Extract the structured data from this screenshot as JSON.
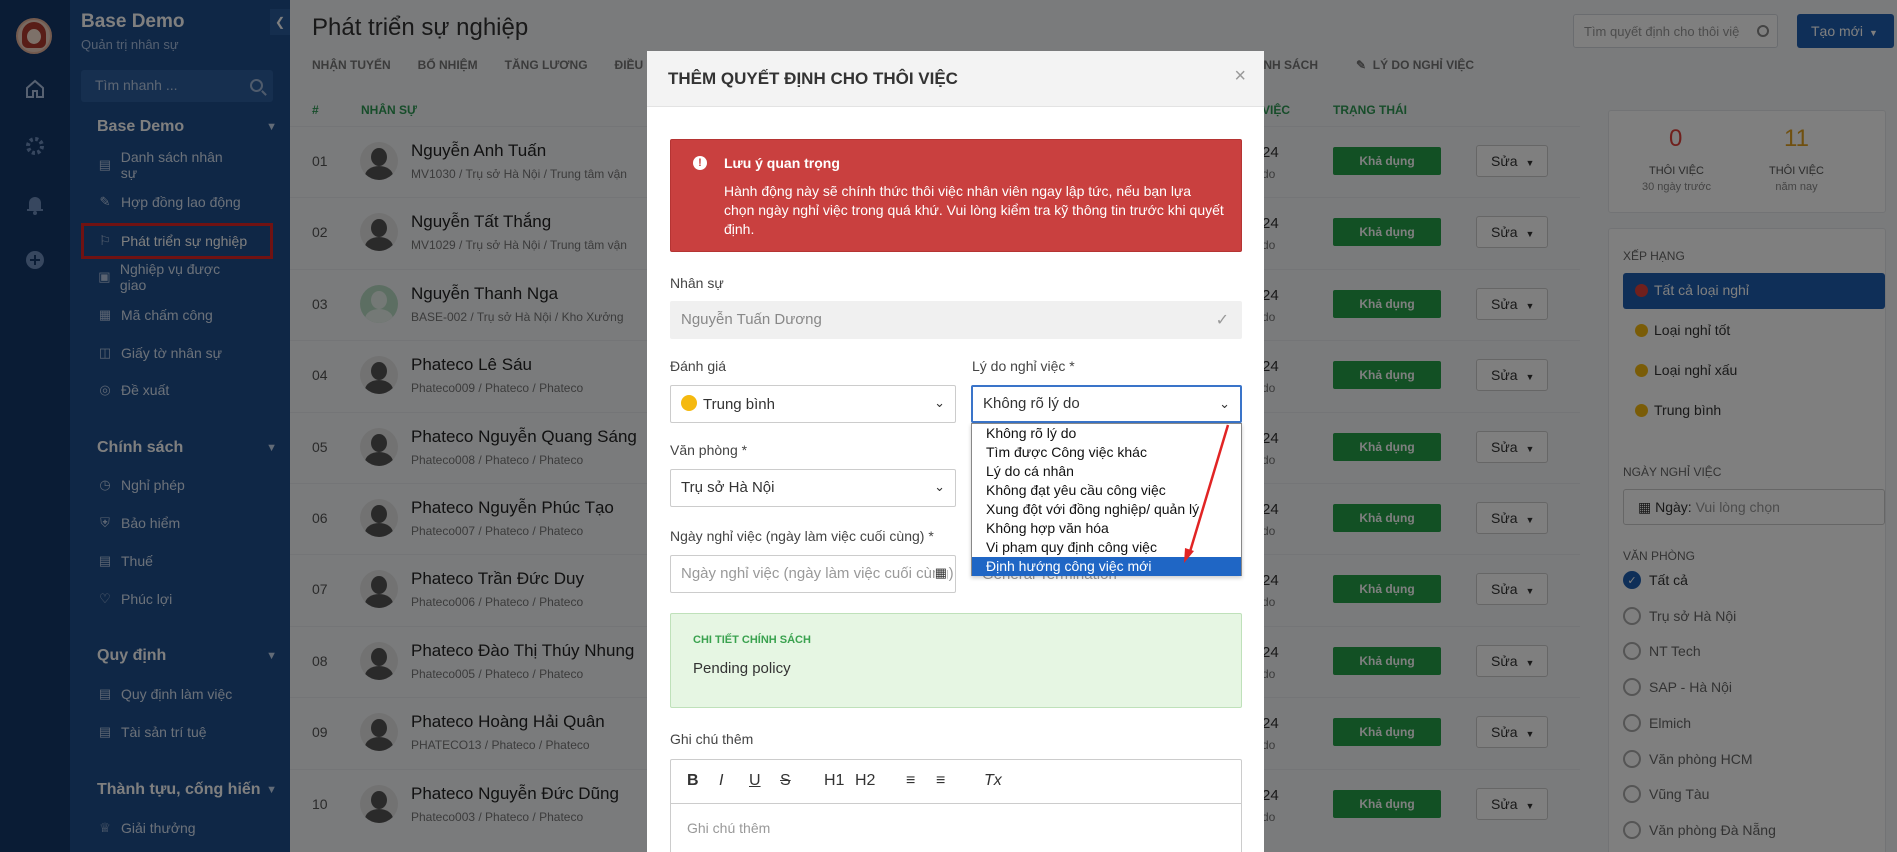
{
  "sidebar": {
    "brand": "Base Demo",
    "subtitle": "Quản trị nhân sự",
    "search_placeholder": "Tìm nhanh ...",
    "group1": "Base Demo",
    "group1_items": [
      "Danh sách nhân sự",
      "Hợp đồng lao động",
      "Phát triển sự nghiệp",
      "Nghiệp vụ được giao",
      "Mã chấm công",
      "Giấy tờ nhân sự",
      "Đề xuất"
    ],
    "group2": "Chính sách",
    "group2_items": [
      "Nghỉ phép",
      "Bảo hiểm",
      "Thuế",
      "Phúc lợi"
    ],
    "group3": "Quy định",
    "group3_items": [
      "Quy định làm việc",
      "Tài sản trí tuệ"
    ],
    "group4": "Thành tựu, cống hiến",
    "group4_items": [
      "Giải thưởng"
    ]
  },
  "header": {
    "title": "Phát triển sự nghiệp",
    "search_placeholder": "Tìm quyết định cho thôi việ",
    "create_label": "Tạo mới",
    "tabs": [
      "NHẬN TUYỂN",
      "BỔ NHIỆM",
      "TĂNG LƯƠNG",
      "ĐIỀU"
    ],
    "tabs_right": [
      "ÍNH SÁCH",
      "LÝ DO NGHỈ VIỆC"
    ]
  },
  "table": {
    "col_num": "#",
    "col_staff": "NHÂN SỰ",
    "col_date": "VIỆC",
    "col_status": "TRẠNG THÁI",
    "rows": [
      {
        "num": "01",
        "name": "Nguyễn Anh Tuấn",
        "sub": "MV1030 / Trụ sở Hà Nội / Trung tâm vận",
        "d1": "24",
        "d2": "do",
        "status": "Khả dụng",
        "edit": "Sửa"
      },
      {
        "num": "02",
        "name": "Nguyễn Tất Thắng",
        "sub": "MV1029 / Trụ sở Hà Nội / Trung tâm vận",
        "d1": "24",
        "d2": "do",
        "status": "Khả dụng",
        "edit": "Sửa"
      },
      {
        "num": "03",
        "name": "Nguyễn Thanh Nga",
        "sub": "BASE-002 / Trụ sở Hà Nội / Kho Xưởng",
        "d1": "24",
        "d2": "do",
        "status": "Khả dụng",
        "edit": "Sửa"
      },
      {
        "num": "04",
        "name": "Phateco Lê Sáu",
        "sub": "Phateco009 / Phateco / Phateco",
        "d1": "24",
        "d2": "do",
        "status": "Khả dụng",
        "edit": "Sửa"
      },
      {
        "num": "05",
        "name": "Phateco Nguyễn Quang Sáng",
        "sub": "Phateco008 / Phateco / Phateco",
        "d1": "24",
        "d2": "do",
        "status": "Khả dụng",
        "edit": "Sửa"
      },
      {
        "num": "06",
        "name": "Phateco Nguyễn Phúc Tạo",
        "sub": "Phateco007 / Phateco / Phateco",
        "d1": "24",
        "d2": "do",
        "status": "Khả dụng",
        "edit": "Sửa"
      },
      {
        "num": "07",
        "name": "Phateco Trần Đức Duy",
        "sub": "Phateco006 / Phateco / Phateco",
        "d1": "24",
        "d2": "do",
        "status": "Khả dụng",
        "edit": "Sửa"
      },
      {
        "num": "08",
        "name": "Phateco Đào Thị Thúy Nhung",
        "sub": "Phateco005 / Phateco / Phateco",
        "d1": "24",
        "d2": "do",
        "status": "Khả dụng",
        "edit": "Sửa"
      },
      {
        "num": "09",
        "name": "Phateco Hoàng Hải Quân",
        "sub": "PHATECO13 / Phateco / Phateco",
        "d1": "24",
        "d2": "do",
        "status": "Khả dụng",
        "edit": "Sửa"
      },
      {
        "num": "10",
        "name": "Phateco Nguyễn Đức Dũng",
        "sub": "Phateco003 / Phateco / Phateco",
        "d1": "24",
        "d2": "do",
        "status": "Khả dụng",
        "edit": "Sửa"
      }
    ]
  },
  "right_panel": {
    "stat1_value": "0",
    "stat1_label": "THÔI VIỆC",
    "stat1_sub": "30 ngày trước",
    "stat2_value": "11",
    "stat2_label": "THÔI VIỆC",
    "stat2_sub": "năm nay",
    "rank_title": "XẾP HẠNG",
    "rank_filters": [
      "Tất cả loại nghỉ",
      "Loại nghỉ tốt",
      "Loại nghỉ xấu",
      "Trung bình"
    ],
    "date_title": "NGÀY NGHỈ VIỆC",
    "date_label": "Ngày:",
    "date_placeholder": "Vui lòng chọn",
    "office_title": "VĂN PHÒNG",
    "offices": [
      "Tất cả",
      "Trụ sở Hà Nội",
      "NT Tech",
      "SAP - Hà Nội",
      "Elmich",
      "Văn phòng HCM",
      "Vũng Tàu",
      "Văn phòng Đà Nẵng"
    ]
  },
  "modal": {
    "title": "THÊM QUYẾT ĐỊNH CHO THÔI VIỆC",
    "close": "×",
    "alert_title": "Lưu ý quan trọng",
    "alert_text": "Hành động này sẽ chính thức thôi việc nhân viên ngay lập tức, nếu bạn lựa chọn ngày nghỉ việc trong quá khứ. Vui lòng kiểm tra kỹ thông tin trước khi quyết định.",
    "staff_label": "Nhân sự",
    "staff_value": "Nguyễn Tuấn Dương",
    "rating_label": "Đánh giá",
    "rating_value": "Trung bình",
    "reason_label": "Lý do nghỉ việc *",
    "reason_value": "Không rõ lý do",
    "office_label": "Văn phòng *",
    "office_value": "Trụ sở Hà Nội",
    "date_label": "Ngày nghỉ việc (ngày làm việc cuối cùng) *",
    "date_placeholder": "Ngày nghỉ việc (ngày làm việc cuối cùng)",
    "hidden_field_text": "General Termination",
    "policy_title": "CHI TIẾT CHÍNH SÁCH",
    "policy_text": "Pending policy",
    "note_label": "Ghi chú thêm",
    "note_placeholder": "Ghi chú thêm",
    "toolbar": [
      "B",
      "I",
      "U",
      "S",
      "H1",
      "H2",
      "ol",
      "ul",
      "Tx"
    ]
  },
  "dropdown": {
    "options": [
      "Không rõ lý do",
      "Tìm được Công việc khác",
      "Lý do cá nhân",
      "Không đạt yêu cầu công việc",
      "Xung đột với đồng nghiệp/ quản lý",
      "Không hợp văn hóa",
      "Vi phạm quy định công việc",
      "Định hướng công việc mới"
    ],
    "selected_index": 7
  },
  "colors": {
    "sidebar": "#1f4e8c",
    "accent": "#1f5fb0",
    "alert": "#c9403f",
    "success": "#24a148",
    "annotation": "#e12424"
  }
}
